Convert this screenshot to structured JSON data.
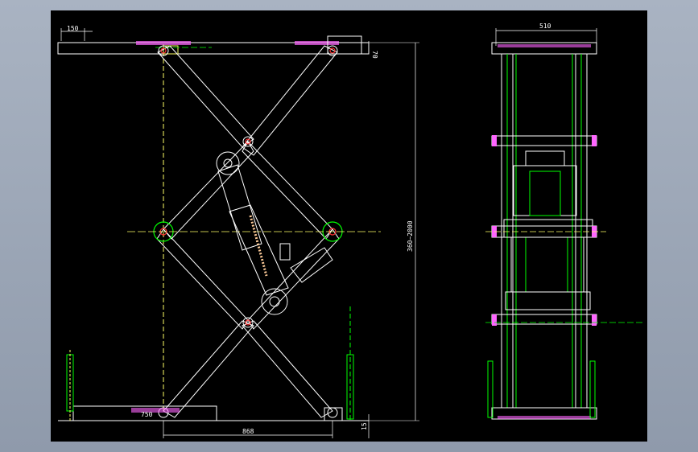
{
  "colors": {
    "background": "#000000",
    "outline": "#ffffff",
    "centerline": "#00ff00",
    "guide": "#ffff66",
    "hatch": "#ff66ff",
    "accent": "#ff3333"
  },
  "dimensions": {
    "top_left_width": "150",
    "top_right_height": "70",
    "vertical_range": "360~2000",
    "base_width": "868",
    "base_foot_label": "750",
    "base_height": "15",
    "side_view_width": "510"
  }
}
